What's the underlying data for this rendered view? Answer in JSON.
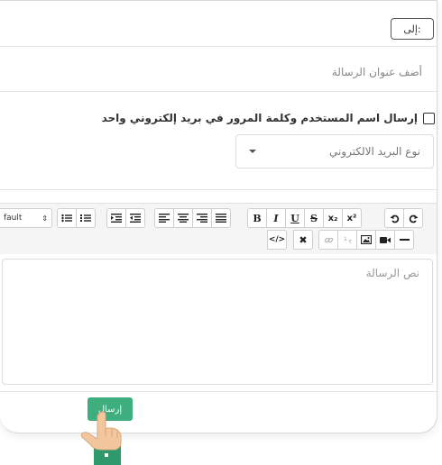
{
  "compose": {
    "to_label": "إلى:",
    "subject_placeholder": "أضف عنوان الرسالة",
    "single_email_checkbox_label": "إرسال اسم المستخدم وكلمة المرور في بريد إلكتروني واحد",
    "email_type_select": "نوع البريد الالكتروني",
    "message_placeholder": "نص الرسالة",
    "send_label": "إرسال"
  },
  "toolbar": {
    "font_select_value": "fault",
    "bold": "B",
    "italic": "I",
    "underline": "U",
    "strike": "S",
    "subscript": "x₂",
    "superscript": "x²",
    "undo_icon": "undo-icon",
    "redo_icon": "redo-icon"
  },
  "colors": {
    "send_button": "#3fae7f",
    "toolbar_bg": "#f5f5f5"
  }
}
